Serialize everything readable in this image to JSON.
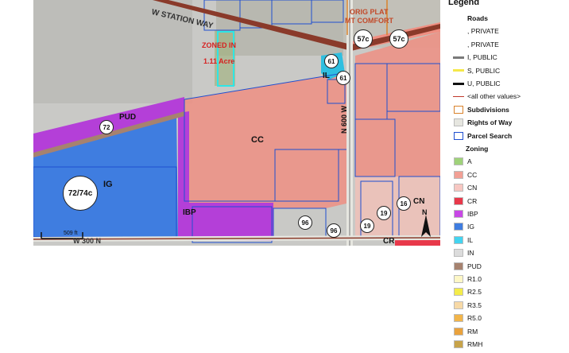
{
  "map": {
    "labels": {
      "station_way": "W STATION WAY",
      "zoned_in": "ZONED IN",
      "acre": "1.11 Acre",
      "oric_plat": "ORIG PLAT",
      "mt_comfort": "MT COMFORT",
      "pud": "PUD",
      "cc": "CC",
      "ig": "IG",
      "ibp": "IBP",
      "il": "IL",
      "cn": "CN",
      "cr": "CR",
      "n600w": "N 600 W",
      "w300n": "W 300 N",
      "scale": "509 ft",
      "north": "N"
    },
    "shields": [
      "57c",
      "57c",
      "61",
      "61",
      "72",
      "72/74c",
      "96",
      "96",
      "19",
      "19",
      "16"
    ],
    "colors": {
      "cc": "#ef8f82",
      "ig": "#3f7de0",
      "ibp": "#b43fd8",
      "il": "#2fbfe0",
      "subject": "#2ee6e6",
      "road": "#8a3a2a",
      "parcel": "#1f4fd0"
    }
  },
  "legend": {
    "title": "Legend",
    "items": [
      {
        "label": "Roads",
        "bold": true,
        "sym": "none"
      },
      {
        "label": ", PRIVATE",
        "bold": false,
        "sym": "none"
      },
      {
        "label": ", PRIVATE",
        "bold": false,
        "sym": "none"
      },
      {
        "label": "I, PUBLIC",
        "bold": false,
        "sym": "line",
        "color": "#7a7a7a"
      },
      {
        "label": "S, PUBLIC",
        "bold": false,
        "sym": "line",
        "color": "#f5e84a"
      },
      {
        "label": "U, PUBLIC",
        "bold": false,
        "sym": "line",
        "color": "#111111"
      },
      {
        "label": "<all other values>",
        "bold": false,
        "sym": "thinline",
        "color": "#c0392b"
      },
      {
        "label": "Subdivisions",
        "bold": true,
        "sym": "outline",
        "color": "#d9822b"
      },
      {
        "label": "Rights of Way",
        "bold": true,
        "sym": "fill",
        "color": "#e6e6e0"
      },
      {
        "label": "Parcel Search",
        "bold": true,
        "sym": "outline",
        "color": "#1f4fd0"
      },
      {
        "label": "Zoning",
        "bold": true,
        "sym": "none"
      },
      {
        "label": "A",
        "bold": false,
        "sym": "fill",
        "color": "#9fd27a"
      },
      {
        "label": "CC",
        "bold": false,
        "sym": "fill",
        "color": "#f2a095"
      },
      {
        "label": "CN",
        "bold": false,
        "sym": "fill",
        "color": "#f7c7c2"
      },
      {
        "label": "CR",
        "bold": false,
        "sym": "fill",
        "color": "#e8384a"
      },
      {
        "label": "IBP",
        "bold": false,
        "sym": "fill",
        "color": "#c848e6"
      },
      {
        "label": "IG",
        "bold": false,
        "sym": "fill",
        "color": "#3f7de0"
      },
      {
        "label": "IL",
        "bold": false,
        "sym": "fill",
        "color": "#44d4f0"
      },
      {
        "label": "IN",
        "bold": false,
        "sym": "fill",
        "color": "#dcdcdc"
      },
      {
        "label": "PUD",
        "bold": false,
        "sym": "fill",
        "color": "#a6826f"
      },
      {
        "label": "R1.0",
        "bold": false,
        "sym": "fill",
        "color": "#fdf7c6"
      },
      {
        "label": "R2.5",
        "bold": false,
        "sym": "fill",
        "color": "#f4ec4a"
      },
      {
        "label": "R3.5",
        "bold": false,
        "sym": "fill",
        "color": "#f7d9a6"
      },
      {
        "label": "R5.0",
        "bold": false,
        "sym": "fill",
        "color": "#f2b54a"
      },
      {
        "label": "RM",
        "bold": false,
        "sym": "fill",
        "color": "#eaa23c"
      },
      {
        "label": "RMH",
        "bold": false,
        "sym": "fill",
        "color": "#c7a34a"
      }
    ]
  }
}
